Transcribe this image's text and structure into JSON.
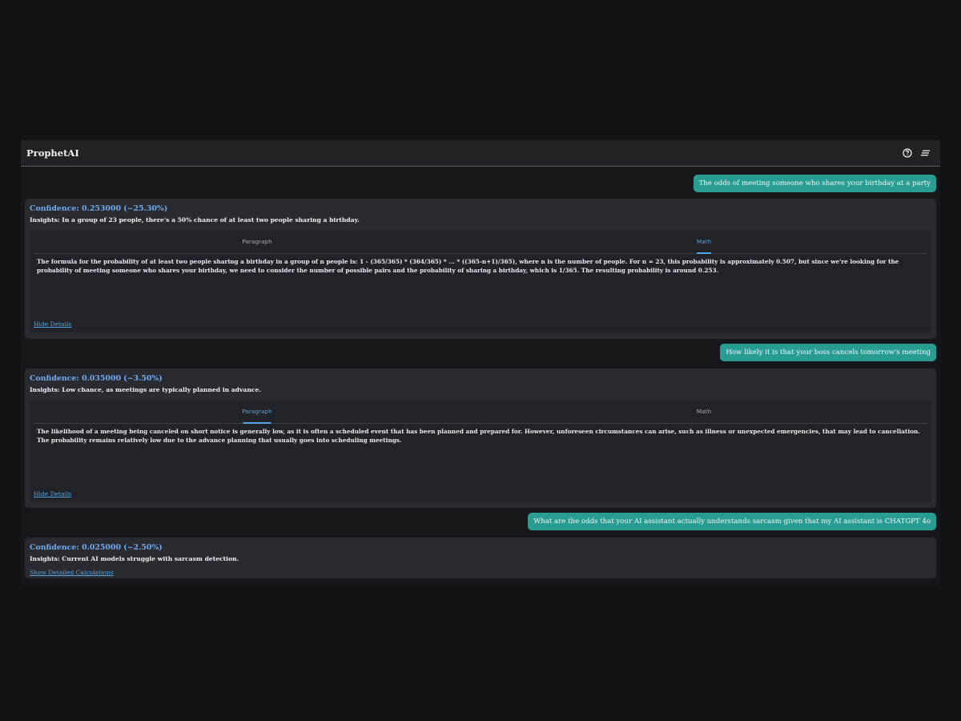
{
  "app": {
    "title": "ProphetAI",
    "icons": [
      "help-circle-icon",
      "menu-icon"
    ]
  },
  "messages": [
    {
      "user_text": "The odds of meeting someone who shares your birthday at a party",
      "confidence": "Confidence: 0.253000 (~25.30%)",
      "insights": "Insights: In a group of 23 people, there's a 50% chance of at least two people sharing a birthday.",
      "tabs": [
        "Paragraph",
        "Math"
      ],
      "active_tab": "Math",
      "detail_text": "The formula for the probability of at least two people sharing a birthday in a group of n people is: 1 - (365/365) * (364/365) * ... * ((365-n+1)/365), where n is the number of people. For n = 23, this probability is approximately 0.507, but since we're looking for the probability of meeting someone who shares your birthday, we need to consider the number of possible pairs and the probability of sharing a birthday, which is 1/365. The resulting probability is around 0.253.",
      "toggle_label": "Hide Details"
    },
    {
      "user_text": "How likely it is that your boss cancels tomorrow's meeting",
      "confidence": "Confidence: 0.035000 (~3.50%)",
      "insights": "Insights: Low chance, as meetings are typically planned in advance.",
      "tabs": [
        "Paragraph",
        "Math"
      ],
      "active_tab": "Paragraph",
      "detail_text": "The likelihood of a meeting being canceled on short notice is generally low, as it is often a scheduled event that has been planned and prepared for. However, unforeseen circumstances can arise, such as illness or unexpected emergencies, that may lead to cancellation. The probability remains relatively low due to the advance planning that usually goes into scheduling meetings.",
      "toggle_label": "Hide Details"
    },
    {
      "user_text": "What are the odds that your AI assistant actually understands sarcasm given that my AI assistant is CHATGPT 4o",
      "confidence": "Confidence: 0.025000 (~2.50%)",
      "insights": "Insights: Current AI models struggle with sarcasm detection.",
      "toggle_label": "Show Detailed Calculations"
    }
  ],
  "colors": {
    "accent": "#4fa6e3",
    "confidence": "#6eaaf0",
    "user_bubble": "#2a9d93",
    "card": "#2a2b31",
    "background": "#111214"
  }
}
